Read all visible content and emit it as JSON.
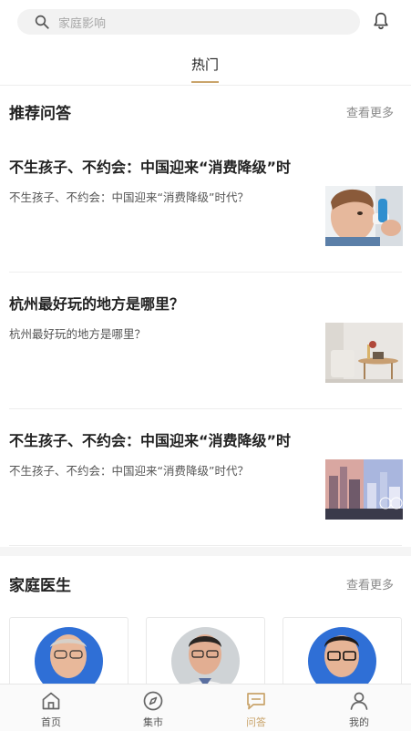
{
  "search": {
    "placeholder": "家庭影响"
  },
  "tabs": [
    {
      "label": "热门",
      "active": true
    }
  ],
  "recommended": {
    "title": "推荐问答",
    "more": "查看更多",
    "items": [
      {
        "title": "不生孩子、不约会：中国迎来“消费降级”时",
        "desc": "不生孩子、不约会：中国迎来“消费降级”时代？",
        "thumb": "child-inhaler-photo"
      },
      {
        "title": "杭州最好玩的地方是哪里？",
        "desc": "杭州最好玩的地方是哪里？",
        "thumb": "living-room-photo"
      },
      {
        "title": "不生孩子、不约会：中国迎来“消费降级”时",
        "desc": "不生孩子、不约会：中国迎来“消费降级”时代？",
        "thumb": "city-illustration"
      }
    ]
  },
  "doctors": {
    "title": "家庭医生",
    "more": "查看更多",
    "items": [
      {
        "avatar": "doctor-avatar-1"
      },
      {
        "avatar": "doctor-avatar-2"
      },
      {
        "avatar": "doctor-avatar-3"
      }
    ]
  },
  "bottom_nav": [
    {
      "label": "首页",
      "icon": "home-icon",
      "active": false
    },
    {
      "label": "集市",
      "icon": "compass-icon",
      "active": false
    },
    {
      "label": "问答",
      "icon": "chat-icon",
      "active": true
    },
    {
      "label": "我的",
      "icon": "user-icon",
      "active": false
    }
  ],
  "colors": {
    "accent": "#c9a46b",
    "divider": "#eeeeee",
    "search_bg": "#f2f2f2"
  }
}
